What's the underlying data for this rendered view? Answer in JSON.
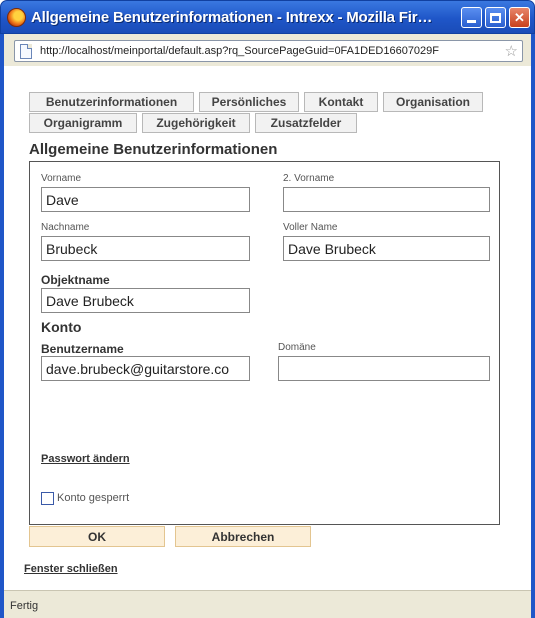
{
  "window": {
    "title": "Allgemeine Benutzerinformationen - Intrexx - Mozilla Fir…"
  },
  "browser": {
    "url": "http://localhost/meinportal/default.asp?rq_SourcePageGuid=0FA1DED16607029F",
    "status": "Fertig"
  },
  "tabs": {
    "row1": [
      "Benutzerinformationen",
      "Persönliches",
      "Kontakt",
      "Organisation"
    ],
    "row2": [
      "Organigramm",
      "Zugehörigkeit",
      "Zusatzfelder"
    ]
  },
  "form": {
    "section_title": "Allgemeine Benutzerinformationen",
    "vorname_label": "Vorname",
    "vorname_value": "Dave",
    "vorname2_label": "2. Vorname",
    "vorname2_value": "",
    "nachname_label": "Nachname",
    "nachname_value": "Brubeck",
    "vollername_label": "Voller Name",
    "vollername_value": "Dave Brubeck",
    "objektname_label": "Objektname",
    "objektname_value": "Dave Brubeck",
    "konto_heading": "Konto",
    "benutzername_label": "Benutzername",
    "benutzername_value": "dave.brubeck@guitarstore.co",
    "domane_label": "Domäne",
    "domane_value": "",
    "passwort_link": "Passwort ändern",
    "konto_gesperrt_label": "Konto gesperrt"
  },
  "buttons": {
    "ok": "OK",
    "cancel": "Abbrechen"
  },
  "footer": {
    "close_link": "Fenster schließen"
  }
}
